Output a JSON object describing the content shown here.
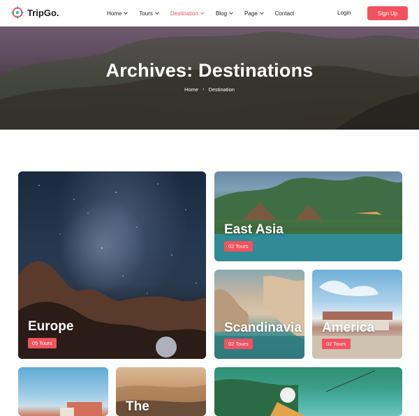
{
  "brand": {
    "name": "TripGo.",
    "accent": "#f2525f"
  },
  "nav": {
    "items": [
      {
        "label": "Home",
        "has_dropdown": true,
        "active": false
      },
      {
        "label": "Tours",
        "has_dropdown": true,
        "active": false
      },
      {
        "label": "Destination",
        "has_dropdown": true,
        "active": true
      },
      {
        "label": "Blog",
        "has_dropdown": true,
        "active": false
      },
      {
        "label": "Page",
        "has_dropdown": true,
        "active": false
      },
      {
        "label": "Contact",
        "has_dropdown": false,
        "active": false
      }
    ],
    "login_label": "Login",
    "signup_label": "Sign Up"
  },
  "hero": {
    "title": "Archives: Destinations",
    "breadcrumb": [
      "Home",
      "Destination"
    ]
  },
  "destinations": [
    {
      "name": "Europe",
      "tours": "05 Tours"
    },
    {
      "name": "East Asia",
      "tours": "02 Tours"
    },
    {
      "name": "Scandinavia",
      "tours": "02 Tours"
    },
    {
      "name": "America",
      "tours": "02 Tours"
    },
    {
      "name": "",
      "tours": ""
    },
    {
      "name": "The",
      "tours": ""
    },
    {
      "name": "",
      "tours": ""
    }
  ]
}
